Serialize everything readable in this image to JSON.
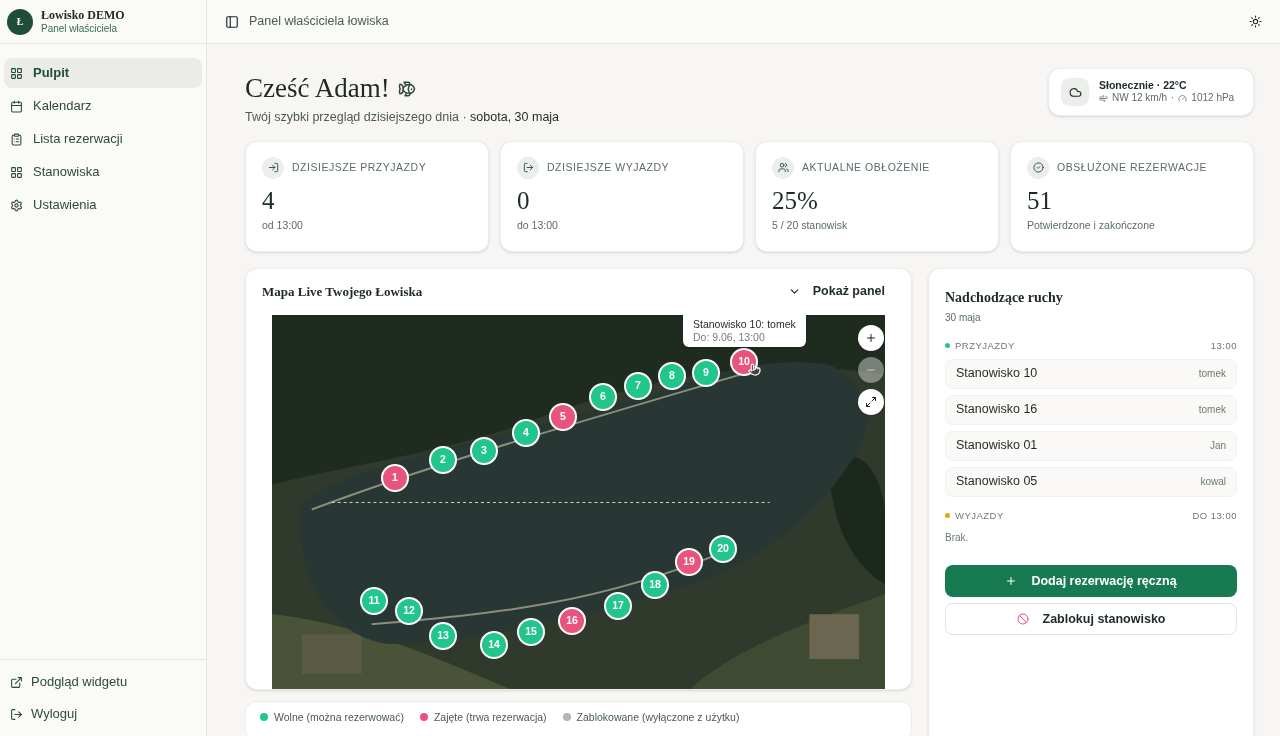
{
  "brand": {
    "logo_letter": "Ł",
    "name": "Łowisko DEMO",
    "subtitle": "Panel właściciela"
  },
  "sidebar": {
    "items": [
      {
        "label": "Pulpit",
        "selected": true
      },
      {
        "label": "Kalendarz",
        "selected": false
      },
      {
        "label": "Lista rezerwacji",
        "selected": false
      },
      {
        "label": "Stanowiska",
        "selected": false
      },
      {
        "label": "Ustawienia",
        "selected": false
      }
    ],
    "footer_items": [
      {
        "label": "Podgląd widgetu"
      },
      {
        "label": "Wyloguj"
      }
    ]
  },
  "header": {
    "title": "Panel właściciela łowiska"
  },
  "greeting": {
    "title": "Cześć Adam!",
    "subtitle": "Twój szybki przegląd dzisiejszego dnia · ",
    "date": "sobota, 30 maja"
  },
  "weather": {
    "summary": "Słonecznie · 22°C",
    "wind": "NW 12 km/h",
    "separator": "·",
    "pressure": "1012 hPa"
  },
  "stats": [
    {
      "label": "DZISIEJSZE PRZYJAZDY",
      "value": "4",
      "note": "od 13:00"
    },
    {
      "label": "DZISIEJSZE WYJAZDY",
      "value": "0",
      "note": "do 13:00"
    },
    {
      "label": "AKTUALNE OBŁOŻENIE",
      "value": "25%",
      "note": "5 / 20 stanowisk"
    },
    {
      "label": "OBSŁUŻONE REZERWACJE",
      "value": "51",
      "note": "Potwierdzone i zakończone"
    }
  ],
  "map": {
    "title": "Mapa Live Twojego Łowiska",
    "toggle": "Pokaż panel",
    "tooltip": {
      "title": "Stanowisko 10: tomek",
      "detail": "Do: 9.06, 13:00"
    },
    "zoom_controls": [
      {
        "kind": "zoom_in",
        "disabled": false
      },
      {
        "kind": "zoom_out",
        "disabled": true
      },
      {
        "kind": "fullscreen",
        "disabled": false
      }
    ],
    "markers": [
      {
        "label": "1",
        "color": "#e8547e"
      },
      {
        "label": "2",
        "color": "#22c58b"
      },
      {
        "label": "3",
        "color": "#22c58b"
      },
      {
        "label": "4",
        "color": "#22c58b"
      },
      {
        "label": "5",
        "color": "#e8547e"
      },
      {
        "label": "6",
        "color": "#22c58b"
      },
      {
        "label": "7",
        "color": "#22c58b"
      },
      {
        "label": "8",
        "color": "#22c58b"
      },
      {
        "label": "9",
        "color": "#22c58b"
      },
      {
        "label": "10",
        "color": "#e8547e"
      },
      {
        "label": "11",
        "color": "#22c58b"
      },
      {
        "label": "12",
        "color": "#22c58b"
      },
      {
        "label": "13",
        "color": "#22c58b"
      },
      {
        "label": "14",
        "color": "#22c58b"
      },
      {
        "label": "15",
        "color": "#22c58b"
      },
      {
        "label": "16",
        "color": "#e8547e"
      },
      {
        "label": "17",
        "color": "#22c58b"
      },
      {
        "label": "18",
        "color": "#22c58b"
      },
      {
        "label": "19",
        "color": "#e8547e"
      },
      {
        "label": "20",
        "color": "#22c58b"
      }
    ]
  },
  "legend": [
    {
      "label": "Wolne (można rezerwować)",
      "color": "#22c58b"
    },
    {
      "label": "Zajęte (trwa rezerwacja)",
      "color": "#e8547e"
    },
    {
      "label": "Zablokowane (wyłączone z użytku)",
      "color": "#b4b4b4"
    }
  ],
  "movements": {
    "title": "Nadchodzące ruchy",
    "date": "30 maja",
    "arrivals": {
      "label": "PRZYJAZDY",
      "time": "13:00",
      "color": "#22c58b",
      "rows": [
        {
          "name": "Stanowisko 10",
          "user": "tomek"
        },
        {
          "name": "Stanowisko 16",
          "user": "tomek"
        },
        {
          "name": "Stanowisko 01",
          "user": "Jan"
        },
        {
          "name": "Stanowisko 05",
          "user": "kowal"
        }
      ]
    },
    "departures": {
      "label": "WYJAZDY",
      "time": "DO 13:00",
      "color": "#f59e0b",
      "empty": "Brak."
    },
    "primary_button": "Dodaj rezerwację ręczną",
    "secondary_button": "Zablokuj stanowisko"
  }
}
